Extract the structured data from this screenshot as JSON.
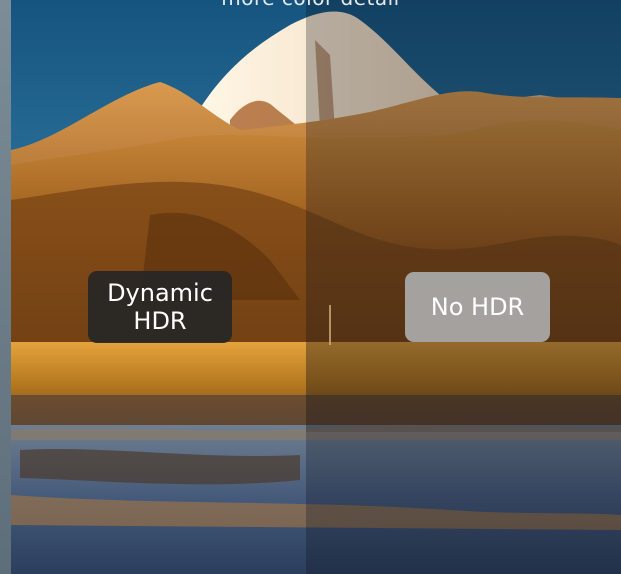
{
  "caption": "more color detail",
  "labels": {
    "dynamic_hdr": "Dynamic\nHDR",
    "no_hdr": "No HDR"
  },
  "colors": {
    "sky_top": "#1b5f8e",
    "sky_bottom": "#6fa9c0",
    "hills_warm": "#b06d1f",
    "hills_dim": "#7b5632",
    "water": "#3c5370"
  }
}
